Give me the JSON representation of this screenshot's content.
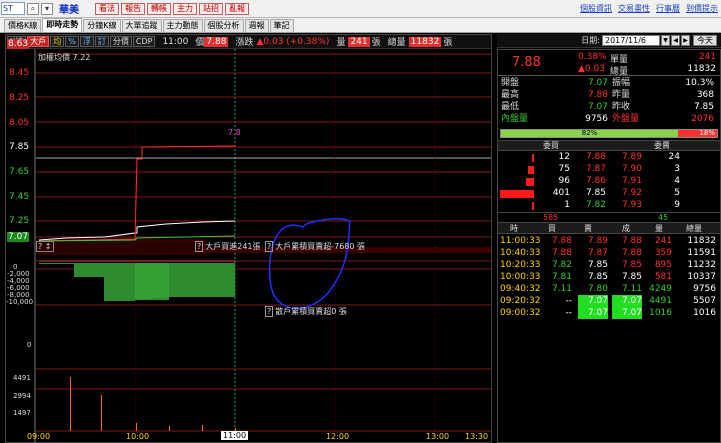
{
  "toolbar": {
    "stock_code": "ST",
    "stock_name": "華美",
    "buttons": [
      "看法",
      "報告",
      "轉帳",
      "主力",
      "站招",
      "亂報"
    ],
    "links": [
      "個股資訊",
      "交易畫性",
      "行事曆",
      "到價提示"
    ]
  },
  "tabs": [
    "價格K線",
    "即時走勢",
    "分鐘K線",
    "大單追蹤",
    "主力動態",
    "個股分析",
    "週報",
    "筆記"
  ],
  "chart_toolbar": {
    "buttons": [
      "K線",
      "大戶",
      "均",
      "%",
      "浮",
      "訂",
      "分價",
      "CDP"
    ],
    "time": "11:00",
    "price_label": "價",
    "price_value": "7.88",
    "change_label": "漲跌",
    "change_value": "▲0.03 (+0.38%)",
    "volume_label": "量",
    "volume_value": "241",
    "volume_unit": "張",
    "total_label": "總量",
    "total_value": "11832",
    "total_unit": "張"
  },
  "chart": {
    "ref_line_label": "加權均價 7.22",
    "highlight_price": "7.8",
    "y_labels": [
      "8.63",
      "8.45",
      "8.25",
      "8.05",
      "7.85",
      "7.65",
      "7.45",
      "7.25",
      "7.07"
    ],
    "big_trader_label": "大戶買進241張",
    "main_force_label": "大戶累積買賣超-7680 張",
    "retail_label": "散戶累積買賣超0 張",
    "mid_y_labels": [
      "0",
      "-2,000",
      "-4,000",
      "-6,000",
      "-8,000",
      "-10,000"
    ],
    "lower_y_label": "0",
    "vol_y_labels": [
      "4491",
      "2994",
      "1497"
    ],
    "x_labels": [
      "09:00",
      "10:00",
      "11:00",
      "12:00",
      "13:00",
      "13:30"
    ],
    "colors": {
      "up": "#ff3030",
      "down": "#33cc33",
      "accent_blue": "#2030ff"
    }
  },
  "date_bar": {
    "label": "日期:",
    "value": "2017/11/6",
    "today_button": "今天"
  },
  "quote": {
    "price": "7.88",
    "percent": "0.38%",
    "change": "▲0.03",
    "single_vol_label": "單量",
    "single_vol": "241",
    "total_vol_label": "總量",
    "total_vol": "11832"
  },
  "stats": [
    {
      "a": "開盤",
      "b": "7.07",
      "bc": "#33cc33",
      "c": "振幅",
      "d": "10.3%",
      "dc": "#ffffff"
    },
    {
      "a": "最高",
      "b": "7.88",
      "bc": "#ff3030",
      "c": "昨量",
      "d": "368",
      "dc": "#ffffff"
    },
    {
      "a": "最低",
      "b": "7.07",
      "bc": "#33cc33",
      "c": "昨收",
      "d": "7.85",
      "dc": "#ffffff"
    },
    {
      "a": "內盤量",
      "b": "9756",
      "bc": "#ffffff",
      "c": "外盤量",
      "d": "2076",
      "dc": "#ff3030"
    }
  ],
  "ratio": {
    "left_pct": "82%",
    "right_pct": "18%",
    "left_value": 0.82
  },
  "orderbook": {
    "header_bid": "委買",
    "header_ask": "委賣",
    "rows": [
      {
        "bid_qty": "12",
        "bid": "7.88",
        "bid_c": "#ff3030",
        "ask": "7.89",
        "ask_c": "#ff3030",
        "ask_qty": "24",
        "bar": 0.03
      },
      {
        "bid_qty": "75",
        "bid": "7.87",
        "bid_c": "#ff3030",
        "ask": "7.90",
        "ask_c": "#ff3030",
        "ask_qty": "3",
        "bar": 0.19
      },
      {
        "bid_qty": "96",
        "bid": "7.86",
        "bid_c": "#ff3030",
        "ask": "7.91",
        "ask_c": "#ff3030",
        "ask_qty": "4",
        "bar": 0.24
      },
      {
        "bid_qty": "401",
        "bid": "7.85",
        "bid_c": "#ffffff",
        "ask": "7.92",
        "ask_c": "#ff3030",
        "ask_qty": "5",
        "bar": 1.0
      },
      {
        "bid_qty": "1",
        "bid": "7.82",
        "bid_c": "#33cc33",
        "ask": "7.93",
        "ask_c": "#ff3030",
        "ask_qty": "9",
        "bar": 0.01
      }
    ],
    "bid_total": "585",
    "ask_total": "45"
  },
  "trades": {
    "headers": [
      "時",
      "買",
      "賣",
      "成",
      "量",
      "總量"
    ],
    "rows": [
      {
        "t": "11:00:33",
        "b": "7.88",
        "bc": "#ff3030",
        "s": "7.89",
        "sc": "#ff3030",
        "p": "7.88",
        "pc": "#ff3030",
        "v": "241",
        "vc": "#ff3030",
        "tot": "11832",
        "hl": ""
      },
      {
        "t": "10:40:33",
        "b": "7.88",
        "bc": "#ff3030",
        "s": "7.87",
        "sc": "#ff3030",
        "p": "7.88",
        "pc": "#ff3030",
        "v": "359",
        "vc": "#ff3030",
        "tot": "11591",
        "hl": ""
      },
      {
        "t": "10:20:33",
        "b": "7.82",
        "bc": "#33cc33",
        "s": "7.85",
        "sc": "#ffffff",
        "p": "7.85",
        "pc": "#ff3030",
        "v": "895",
        "vc": "#ff3030",
        "tot": "11232",
        "hl": ""
      },
      {
        "t": "10:00:33",
        "b": "7.81",
        "bc": "#33cc33",
        "s": "7.85",
        "sc": "#ffffff",
        "p": "7.85",
        "pc": "#ffffff",
        "v": "581",
        "vc": "#ff3030",
        "tot": "10337",
        "hl": ""
      },
      {
        "t": "09:40:32",
        "b": "7.11",
        "bc": "#33cc33",
        "s": "7.80",
        "sc": "#33cc33",
        "p": "7.11",
        "pc": "#33cc33",
        "v": "4249",
        "vc": "#33cc33",
        "tot": "9756",
        "hl": ""
      },
      {
        "t": "09:20:32",
        "b": "--",
        "bc": "#ffffff",
        "s": "7.07",
        "sc": "#ffffff",
        "p": "7.07",
        "pc": "#ffffff",
        "v": "4491",
        "vc": "#33cc33",
        "tot": "5507",
        "hl": "green"
      },
      {
        "t": "09:00:32",
        "b": "--",
        "bc": "#ffffff",
        "s": "7.07",
        "sc": "#ffffff",
        "p": "7.07",
        "pc": "#ffffff",
        "v": "1016",
        "vc": "#33cc33",
        "tot": "1016",
        "hl": "green"
      }
    ]
  }
}
